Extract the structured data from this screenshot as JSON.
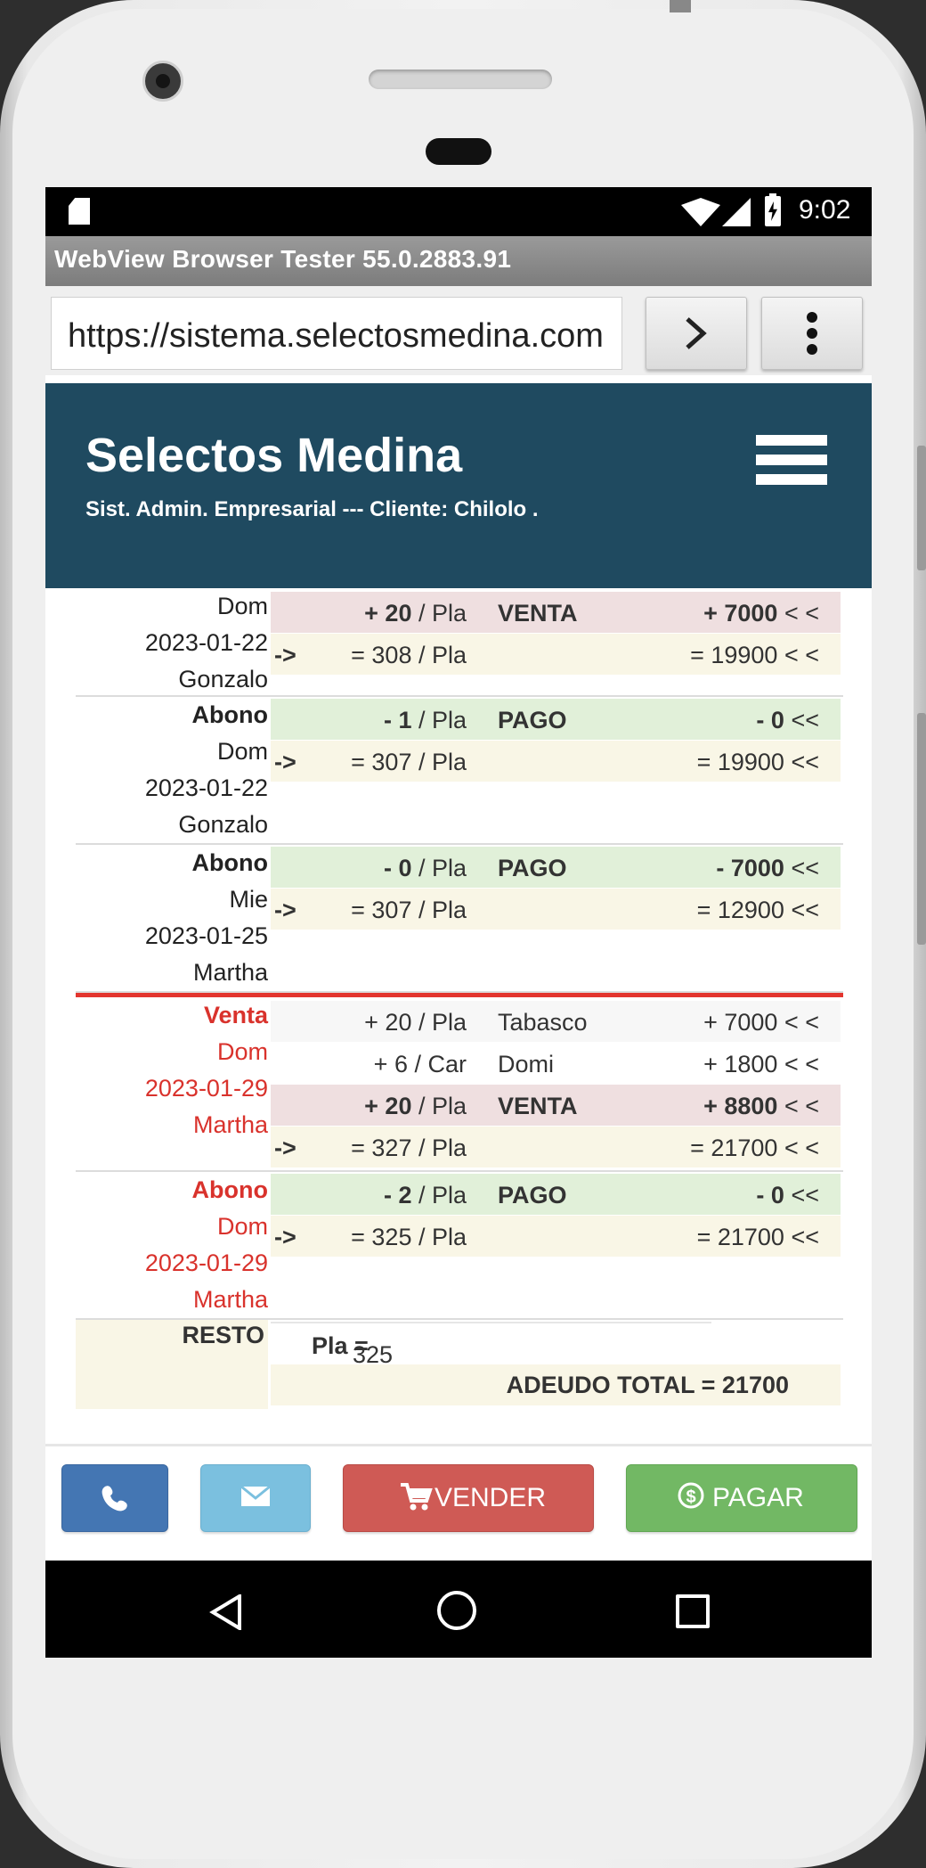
{
  "status_bar": {
    "time": "9:02"
  },
  "browser": {
    "title": "WebView Browser Tester 55.0.2883.91",
    "url": "https://sistema.selectosmedina.com"
  },
  "app": {
    "brand": "Selectos Medina",
    "subtitle": "Sist. Admin. Empresarial --- Cliente: Chilolo ."
  },
  "entries": [
    {
      "date": {
        "type": "",
        "weekday": "Dom",
        "date": "2023-01-22",
        "user": "Gonzalo"
      },
      "rows": [
        {
          "style": "venta",
          "prefix": "",
          "sign": "+ ",
          "qty": "20",
          "unit": " / Pla",
          "desc": "VENTA",
          "amt_sign": "+ ",
          "amt": "7000",
          "suffix": " < <"
        },
        {
          "style": "sum",
          "prefix": "->",
          "sign": "= ",
          "qty": "308",
          "unit": " / Pla",
          "desc": "",
          "amt_sign": "= ",
          "amt": "19900",
          "suffix": " < <"
        }
      ]
    },
    {
      "date": {
        "type": "Abono",
        "weekday": "Dom",
        "date": "2023-01-22",
        "user": "Gonzalo"
      },
      "rows": [
        {
          "style": "pago",
          "prefix": "",
          "sign": "- ",
          "qty": "1",
          "unit": " / Pla",
          "desc": "PAGO",
          "amt_sign": "- ",
          "amt": "0",
          "suffix": " <<"
        },
        {
          "style": "sum",
          "prefix": "->",
          "sign": "= ",
          "qty": "307",
          "unit": " / Pla",
          "desc": "",
          "amt_sign": "= ",
          "amt": "19900",
          "suffix": " <<"
        }
      ]
    },
    {
      "date": {
        "type": "Abono",
        "weekday": "Mie",
        "date": "2023-01-25",
        "user": "Martha"
      },
      "rows": [
        {
          "style": "pago",
          "prefix": "",
          "sign": "- ",
          "qty": "0",
          "unit": " / Pla",
          "desc": "PAGO",
          "amt_sign": "- ",
          "amt": "7000",
          "suffix": " <<"
        },
        {
          "style": "sum",
          "prefix": "->",
          "sign": "= ",
          "qty": "307",
          "unit": " / Pla",
          "desc": "",
          "amt_sign": "= ",
          "amt": "12900",
          "suffix": " <<"
        }
      ]
    },
    {
      "date": {
        "type": "Venta",
        "weekday": "Dom",
        "date": "2023-01-29",
        "user": "Martha"
      },
      "rows": [
        {
          "style": "item1",
          "prefix": "",
          "sign": "+ ",
          "qty": "20",
          "unit": " / Pla",
          "desc": "Tabasco",
          "amt_sign": "+ ",
          "amt": "7000",
          "suffix": " < <"
        },
        {
          "style": "item2",
          "prefix": "",
          "sign": "+ ",
          "qty": "6",
          "unit": " / Car",
          "desc": "Domi",
          "amt_sign": "+ ",
          "amt": "1800",
          "suffix": " < <"
        },
        {
          "style": "venta",
          "prefix": "",
          "sign": "+ ",
          "qty": "20",
          "unit": " / Pla",
          "desc": "VENTA",
          "amt_sign": "+ ",
          "amt": "8800",
          "suffix": " < <"
        },
        {
          "style": "sum",
          "prefix": "->",
          "sign": "= ",
          "qty": "327",
          "unit": " / Pla",
          "desc": "",
          "amt_sign": "= ",
          "amt": "21700",
          "suffix": " < <"
        }
      ]
    },
    {
      "date": {
        "type": "Abono",
        "weekday": "Dom",
        "date": "2023-01-29",
        "user": "Martha"
      },
      "rows": [
        {
          "style": "pago",
          "prefix": "",
          "sign": "- ",
          "qty": "2",
          "unit": " / Pla",
          "desc": "PAGO",
          "amt_sign": "- ",
          "amt": "0",
          "suffix": " <<"
        },
        {
          "style": "sum",
          "prefix": "->",
          "sign": "= ",
          "qty": "325",
          "unit": " / Pla",
          "desc": "",
          "amt_sign": "= ",
          "amt": "21700",
          "suffix": " <<"
        }
      ]
    }
  ],
  "resto": {
    "label": "RESTO",
    "product": "Pla =",
    "qty": "325",
    "total_label": "ADEUDO TOTAL = 21700"
  },
  "footer": {
    "vender_label": "VENDER",
    "pagar_label": "PAGAR"
  },
  "colors": {
    "header_bg": "#1f4a60",
    "accent_red": "#d9322c",
    "phone_button": "#4476b3",
    "mail_button": "#7bc0df",
    "vender_button": "#cf5a55",
    "pagar_button": "#72b864"
  },
  "icons": {
    "phone": "phone-icon",
    "mail": "envelope-icon",
    "cart": "cart-icon",
    "dollar": "dollar-circle-icon",
    "menu": "hamburger-icon"
  }
}
